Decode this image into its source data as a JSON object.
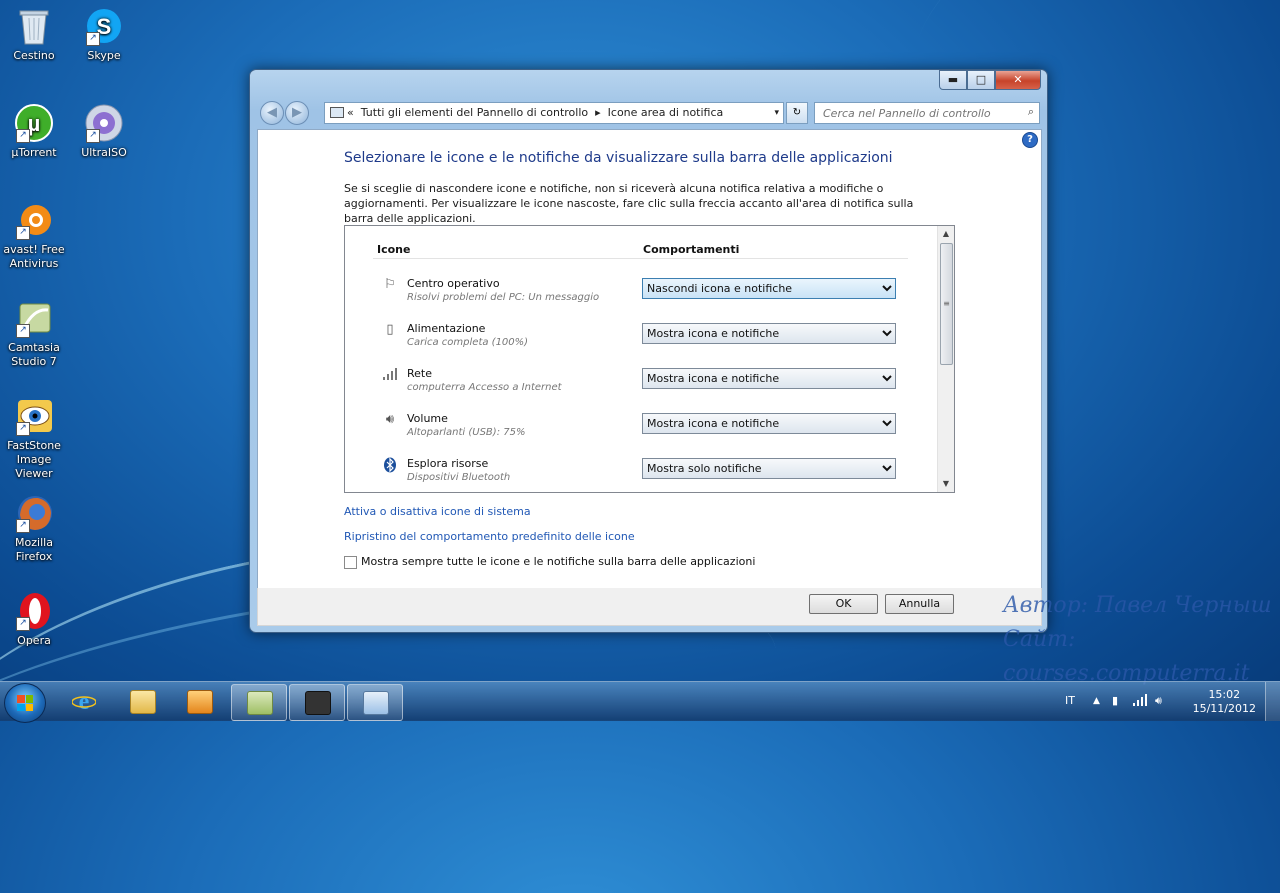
{
  "desktop": {
    "icons": [
      {
        "label": "Cestino",
        "icon": "recycle-bin-icon"
      },
      {
        "label": "Skype",
        "icon": "skype-icon"
      },
      {
        "label": "µTorrent",
        "icon": "utorrent-icon"
      },
      {
        "label": "UltraISO",
        "icon": "ultraiso-icon"
      },
      {
        "label": "avast! Free Antivirus",
        "icon": "avast-icon"
      },
      {
        "label": "Camtasia Studio 7",
        "icon": "camtasia-icon"
      },
      {
        "label": "FastStone Image Viewer",
        "icon": "faststone-icon"
      },
      {
        "label": "Mozilla Firefox",
        "icon": "firefox-icon"
      },
      {
        "label": "Opera",
        "icon": "opera-icon"
      }
    ]
  },
  "window": {
    "controls": {
      "minimize": "▬",
      "maximize": "□",
      "close": "✕"
    },
    "nav": {
      "back": "◀",
      "forward": "▶"
    },
    "address": {
      "crumbs": [
        "«",
        "Tutti gli elementi del Pannello di controllo",
        "▸",
        "Icone area di notifica"
      ],
      "dropdown": "▾"
    },
    "refresh": "↻",
    "search": {
      "placeholder": "Cerca nel Pannello di controllo"
    },
    "help": "?",
    "title": "Selezionare le icone e le notifiche da visualizzare sulla barra delle applicazioni",
    "description": "Se si sceglie di nascondere icone e notifiche, non si riceverà alcuna notifica relativa a modifiche o aggiornamenti. Per visualizzare le icone nascoste, fare clic sulla freccia accanto all'area di notifica sulla barra delle applicazioni.",
    "table": {
      "col_icons": "Icone",
      "col_behavior": "Comportamenti",
      "rows": [
        {
          "name": "Centro operativo",
          "desc": "Risolvi problemi del PC: Un messaggio",
          "value": "Nascondi icona e notifiche",
          "icon": "flag-icon"
        },
        {
          "name": "Alimentazione",
          "desc": "Carica completa (100%)",
          "value": "Mostra icona e notifiche",
          "icon": "power-icon"
        },
        {
          "name": "Rete",
          "desc": "computerra Accesso a Internet",
          "value": "Mostra icona e notifiche",
          "icon": "network-icon"
        },
        {
          "name": "Volume",
          "desc": "Altoparlanti (USB): 75%",
          "value": "Mostra icona e notifiche",
          "icon": "speaker-icon"
        },
        {
          "name": "Esplora risorse",
          "desc": "Dispositivi Bluetooth",
          "value": "Mostra solo notifiche",
          "icon": "bluetooth-icon"
        }
      ],
      "options": [
        "Mostra icona e notifiche",
        "Nascondi icona e notifiche",
        "Mostra solo notifiche"
      ]
    },
    "links": {
      "system_icons": "Attiva o disattiva icone di sistema",
      "restore": "Ripristino del comportamento predefinito delle icone"
    },
    "checkbox_label": "Mostra sempre tutte le icone e le notifiche sulla barra delle applicazioni",
    "ok": "OK",
    "cancel": "Annulla"
  },
  "watermark": {
    "line1": "Автор: Павел Черныш",
    "line2": "Сайт: courses.computerra.it"
  },
  "taskbar": {
    "lang": "IT",
    "time": "15:02",
    "date": "15/11/2012",
    "tray_up": "▲"
  },
  "colors": {
    "link": "#2158b5",
    "title": "#1e3a8a"
  }
}
